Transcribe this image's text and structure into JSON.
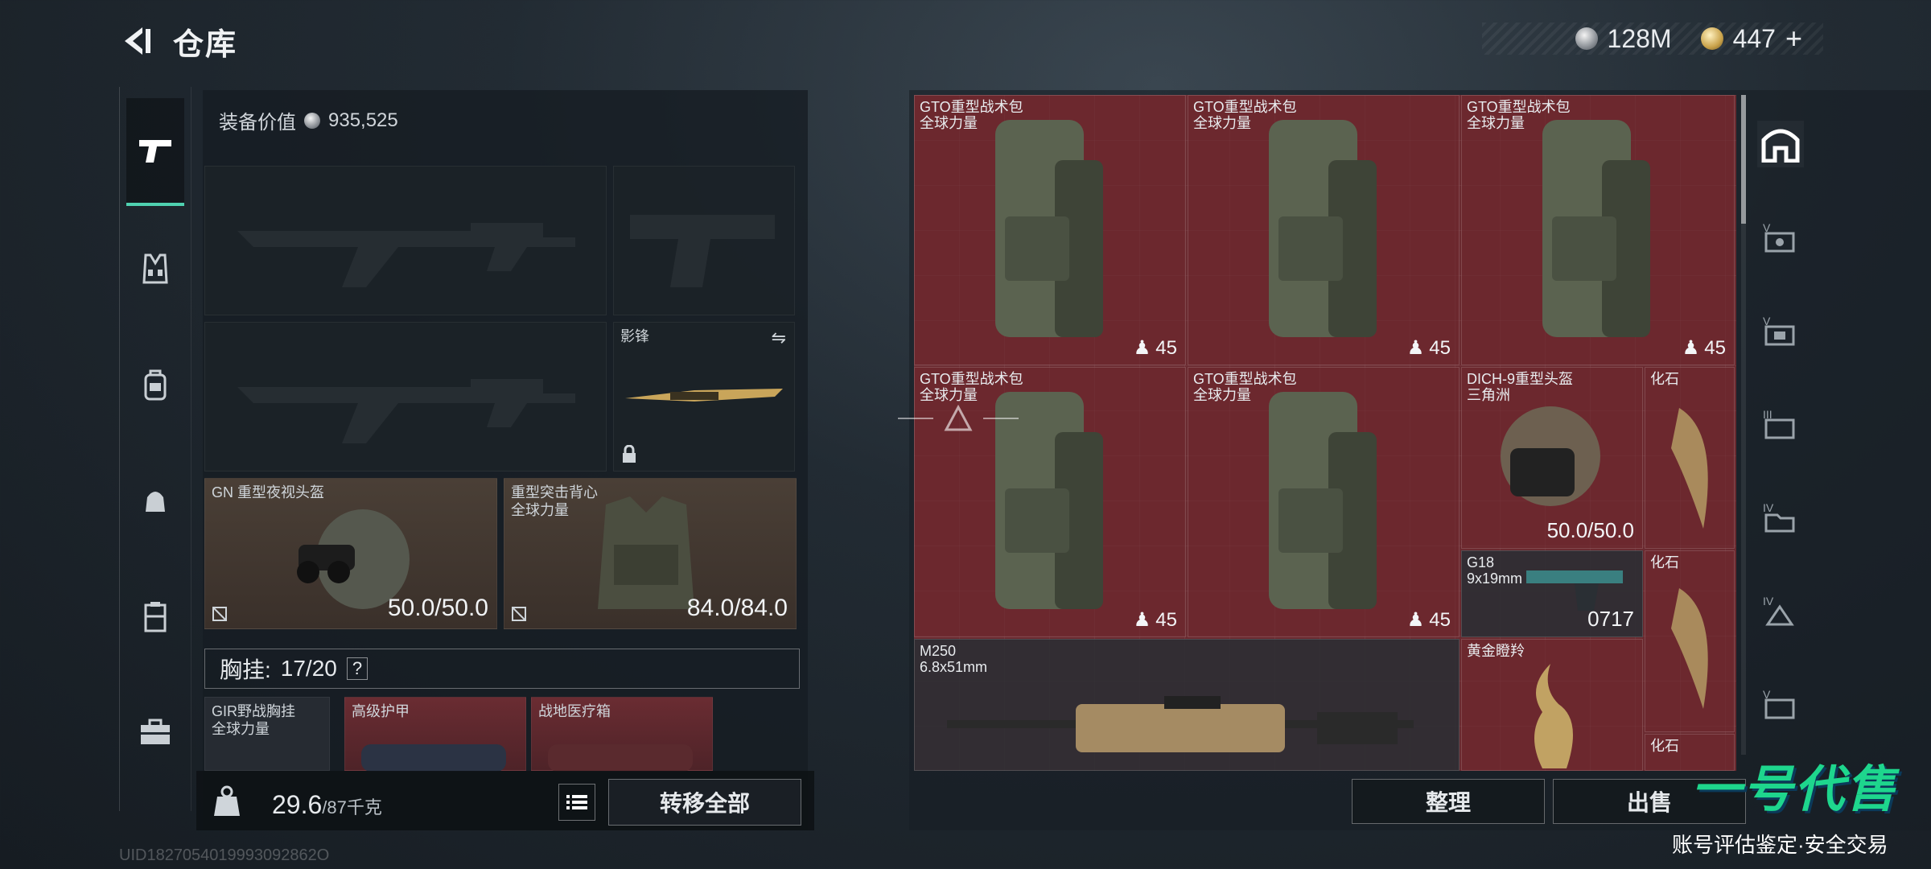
{
  "header": {
    "title": "仓库"
  },
  "currency": {
    "silver": "128M",
    "gold": "447",
    "gold_add": "+"
  },
  "left_panel": {
    "equip_value_label": "装备价值",
    "equip_value": "935,525",
    "melee_name": "影锋",
    "helmet": {
      "name": "GN 重型夜视头盔",
      "durability": "50.0/50.0"
    },
    "armor": {
      "name_line1": "重型突击背心",
      "name_line2": "全球力量",
      "durability": "84.0/84.0"
    },
    "vest": {
      "label": "胸挂:",
      "capacity": "17/20",
      "help": "?"
    },
    "vest_items": [
      {
        "name_line1": "GIR野战胸挂",
        "name_line2": "全球力量"
      },
      {
        "name_line1": "高级护甲",
        "name_line2": ""
      },
      {
        "name_line1": "战地医疗箱",
        "name_line2": ""
      }
    ],
    "weight": "29.6",
    "weight_max": "/87千克",
    "transfer_all": "转移全部"
  },
  "grid_items": [
    {
      "name_line1": "GTO重型战术包",
      "name_line2": "全球力量",
      "stack": "45"
    },
    {
      "name_line1": "GTO重型战术包",
      "name_line2": "全球力量",
      "stack": "45"
    },
    {
      "name_line1": "GTO重型战术包",
      "name_line2": "全球力量",
      "stack": "45"
    },
    {
      "name_line1": "GTO重型战术包",
      "name_line2": "全球力量",
      "stack": "45"
    },
    {
      "name_line1": "GTO重型战术包",
      "name_line2": "全球力量",
      "stack": "45"
    },
    {
      "name_line1": "DICH-9重型头盔",
      "name_line2": "三角洲",
      "durability": "50.0/50.0"
    },
    {
      "name_line1": "化石",
      "name_line2": ""
    },
    {
      "name_line1": "G18",
      "name_line2": "9x19mm",
      "ammo": "0717"
    },
    {
      "name_line1": "化石",
      "name_line2": ""
    },
    {
      "name_line1": "M250",
      "name_line2": "6.8x51mm"
    },
    {
      "name_line1": "黄金瞪羚",
      "name_line2": ""
    },
    {
      "name_line1": "化石",
      "name_line2": ""
    }
  ],
  "actions": {
    "sort": "整理",
    "sell": "出售"
  },
  "watermark": {
    "logo": "一号代售",
    "slogan": "账号评估鉴定·安全交易"
  },
  "status": {
    "line": "UID1827054019993092862O"
  },
  "colors": {
    "accent": "#4fd1b0",
    "cell_red": "#6a2a30",
    "watermark_green": "#1ed68d"
  }
}
